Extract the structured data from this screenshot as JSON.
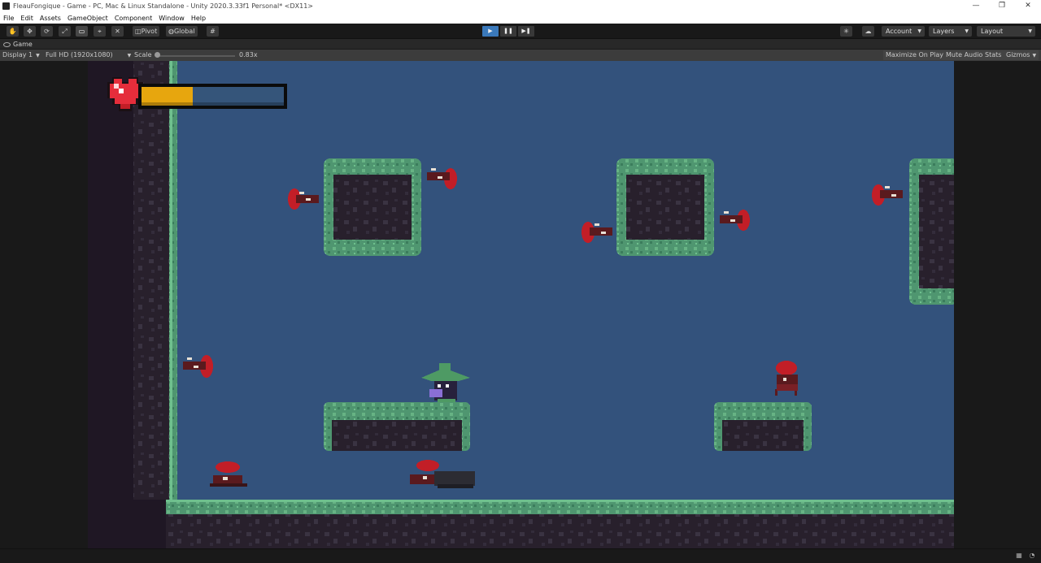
{
  "window": {
    "title": "FleauFongique - Game - PC, Mac & Linux Standalone - Unity 2020.3.33f1 Personal* <DX11>",
    "controls": [
      "—",
      "❐",
      "✕"
    ]
  },
  "menu": [
    "File",
    "Edit",
    "Assets",
    "GameObject",
    "Component",
    "Window",
    "Help"
  ],
  "toolbar": {
    "pivot_label": "Pivot",
    "global_label": "Global",
    "account_label": "Account",
    "layers_label": "Layers",
    "layout_label": "Layout"
  },
  "tab": {
    "label": "Game"
  },
  "gamebar": {
    "display": "Display 1",
    "resolution": "Full HD (1920x1080)",
    "scale_label": "Scale",
    "scale_value": "0.83x",
    "maximize": "Maximize On Play",
    "mute": "Mute Audio",
    "stats": "Stats",
    "gizmos": "Gizmos"
  },
  "colors": {
    "sky": "#33527c",
    "wall": "#1f1724",
    "grass": "#5da67a",
    "grass_dark": "#3b7d5c",
    "dirt": "#28202c",
    "health_fill": "#e7a60e",
    "heart": "#e52d3b",
    "ant_red": "#c21e27"
  },
  "hud": {
    "health": 0.36
  },
  "icons": {
    "hand": "hand-icon",
    "move": "move-icon",
    "rotate": "rotate-icon",
    "scale": "scale-icon",
    "rect": "rect-icon",
    "transform": "transform-icon",
    "custom": "custom-tool-icon",
    "play": "play-icon",
    "pause": "pause-icon",
    "step": "step-icon",
    "collab": "collab-icon",
    "cloud": "cloud-icon"
  }
}
